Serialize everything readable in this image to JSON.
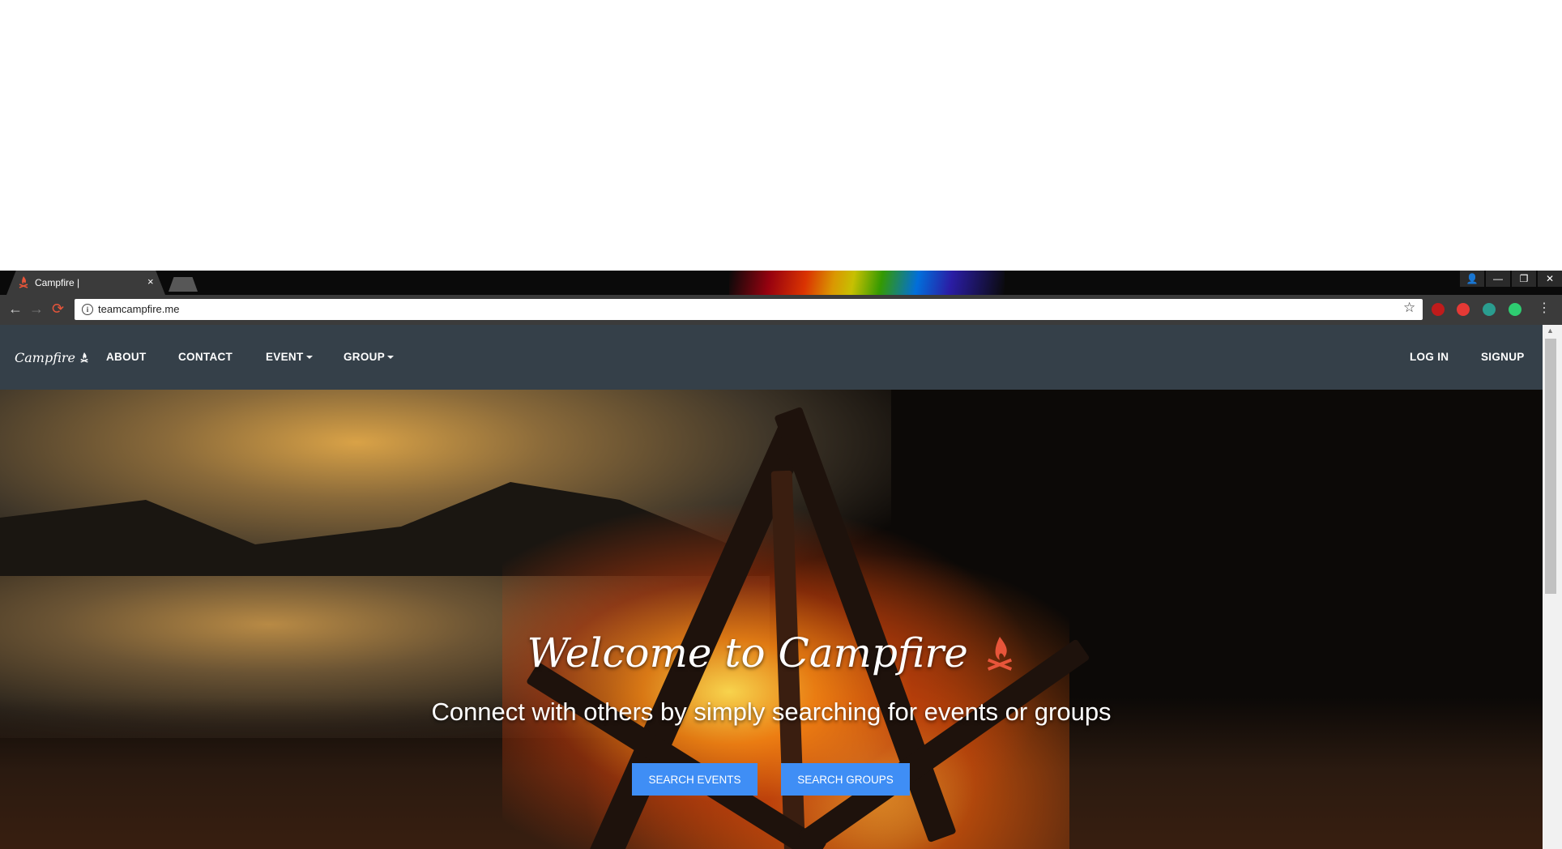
{
  "browser": {
    "tab_title": "Campfire |",
    "tab_close": "×",
    "url": "teamcampfire.me",
    "window_controls": [
      "👤",
      "—",
      "❐",
      "✕"
    ],
    "back": "←",
    "forward": "→",
    "reload": "⟳",
    "star": "☆",
    "menu": "⋮",
    "info": "i"
  },
  "nav": {
    "brand": "Campfire",
    "brand_icon": "campfire-icon",
    "links": {
      "about": "ABOUT",
      "contact": "CONTACT",
      "event": "EVENT",
      "group": "GROUP",
      "login": "LOG IN",
      "signup": "SIGNUP"
    },
    "bar_color": "#354049"
  },
  "hero": {
    "title": "Welcome to Campfire",
    "tagline": "Connect with others by simply searching for events or groups",
    "buttons": {
      "search_events": "SEARCH EVENTS",
      "search_groups": "SEARCH GROUPS"
    },
    "button_color": "#3f8ef5",
    "icon_color": "#e8553a"
  }
}
